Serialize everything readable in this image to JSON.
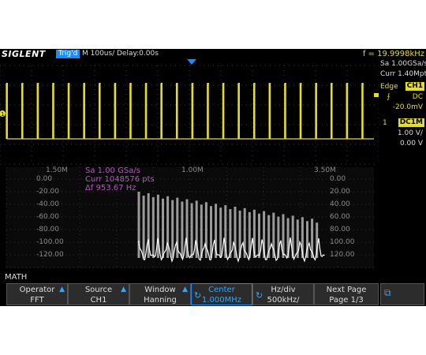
{
  "header": {
    "logo": "SIGLENT",
    "trigger_state": "Trig'd",
    "timebase": "M 100us/",
    "delay": "Delay:0.00s",
    "frequency": "f = 19.9998kHz"
  },
  "acquisition": {
    "sample_rate": "Sa 1.00GSa/s",
    "memory": "Curr 1.40Mpts"
  },
  "trigger": {
    "type": "Edge",
    "source": "CH1",
    "slope_icon": "rising-edge-icon",
    "coupling": "DC",
    "level": "-20.0mV"
  },
  "channel1": {
    "number": "1",
    "coupling_impedance": "DC1M",
    "volts_div": "1.00 V/",
    "offset": "0.00 V",
    "color": "#e6dd28"
  },
  "fft": {
    "sample_rate": "Sa 1.00 GSa/s",
    "points": "Curr 1048576 pts",
    "resolution": "Δf 953.67 Hz",
    "freq_ticks": [
      "1.50M",
      "1.00M",
      "3.50M"
    ],
    "db_ticks": [
      "0.00",
      "-20.00",
      "-40.00",
      "-60.00",
      "-80.00",
      "-100.00",
      "-120.00"
    ],
    "db_ticks_right": [
      "0.00",
      "20.00",
      "40.00",
      "60.00",
      "80.00",
      "100.00",
      "120.00"
    ],
    "overlay_color": "#b05ab8"
  },
  "math_label": "MATH",
  "softkeys": [
    {
      "title": "Operator",
      "value": "FFT"
    },
    {
      "title": "Source",
      "value": "CH1"
    },
    {
      "title": "Window",
      "value": "Hanning"
    },
    {
      "title": "Center",
      "value": "1.000MHz"
    },
    {
      "title": "Hz/div",
      "value": "500kHz/"
    },
    {
      "title": "Next Page",
      "value": "Page 1/3"
    }
  ],
  "icons": {
    "menu_arrow": "up-arrow-icon",
    "knob": "rotary-knob-icon",
    "network": "network-icon"
  },
  "colors": {
    "accent": "#1a8cff",
    "trace": "#e6dd28",
    "fft_trace": "#ffffff",
    "fft_envelope": "#9a9a9a"
  }
}
